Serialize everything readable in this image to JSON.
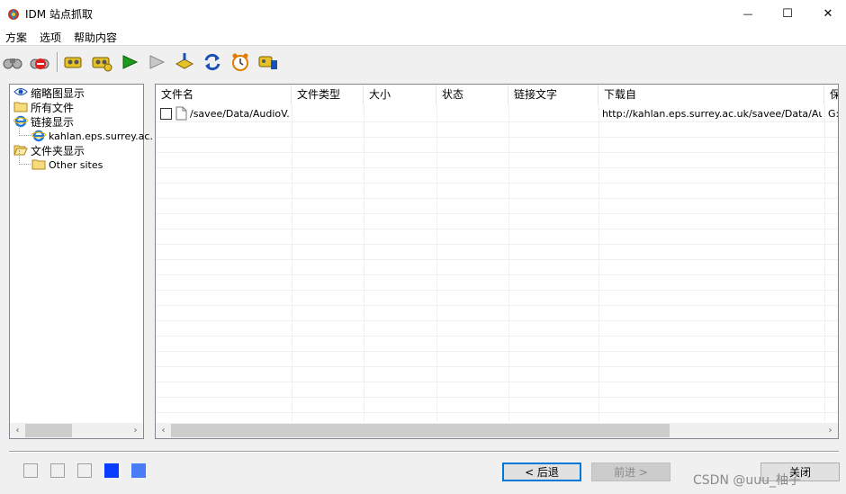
{
  "window": {
    "title": "IDM 站点抓取",
    "minimize_glyph": "—",
    "maximize_glyph": "☐",
    "close_glyph": "✕"
  },
  "menu": {
    "items": [
      "方案",
      "选项",
      "帮助内容"
    ]
  },
  "toolbar": {
    "icons": [
      "binoculars-icon",
      "binoculars-stop-icon",
      "filter-icon",
      "filter-settings-icon",
      "play-icon",
      "play-disabled-icon",
      "import-icon",
      "refresh-icon",
      "scheduler-icon",
      "tasks-icon"
    ]
  },
  "tree": {
    "items": [
      {
        "label": "缩略图显示",
        "icon": "eye-icon"
      },
      {
        "label": "所有文件",
        "icon": "folder-icon"
      },
      {
        "label": "链接显示",
        "icon": "ie-icon"
      },
      {
        "label": "kahlan.eps.surrey.ac.",
        "icon": "ie-icon"
      },
      {
        "label": "文件夹显示",
        "icon": "folder-open-icon"
      },
      {
        "label": "Other sites",
        "icon": "folder-icon"
      }
    ],
    "scroll_left": "‹",
    "scroll_right": "›"
  },
  "list": {
    "columns": [
      "文件名",
      "文件类型",
      "大小",
      "状态",
      "链接文字",
      "下载自",
      "保"
    ],
    "rows": [
      {
        "checked": false,
        "filename": "/savee/Data/AudioV...",
        "filetype": "",
        "size": "",
        "status": "",
        "link_text": "",
        "download_from": "http://kahlan.eps.surrey.ac.uk/savee/Data/Au...",
        "save_to": "G:"
      }
    ],
    "scroll_left": "‹",
    "scroll_right": "›"
  },
  "steps": [
    {
      "state": "inactive",
      "color": "#f0f0f0"
    },
    {
      "state": "inactive",
      "color": "#f0f0f0"
    },
    {
      "state": "inactive",
      "color": "#f0f0f0"
    },
    {
      "state": "active",
      "color": "#0a3cff"
    },
    {
      "state": "active",
      "color": "#4a7df5"
    }
  ],
  "buttons": {
    "back": "< 后退",
    "next": "前进 >",
    "close": "关闭"
  },
  "watermark": "CSDN @uuu_柚子"
}
